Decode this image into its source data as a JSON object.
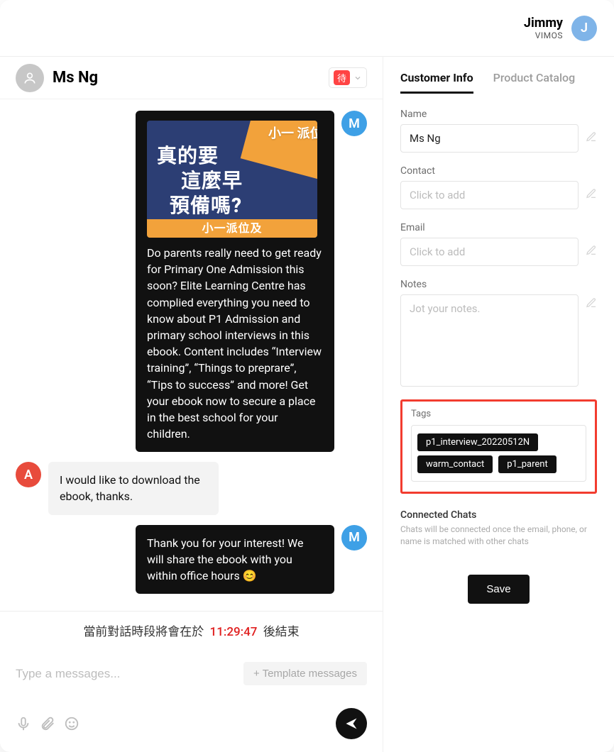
{
  "header": {
    "user_name": "Jimmy",
    "org": "VIMOS",
    "avatar_initial": "J"
  },
  "chat": {
    "contact_name": "Ms Ng",
    "status_badge": "待",
    "messages": [
      {
        "dir": "out",
        "avatar": "M",
        "has_promo": true,
        "promo": {
          "corner": "小一\n派位",
          "main_l1": "真的要",
          "main_l2": "這麼早",
          "main_l3": "預備嗎?",
          "strip": "小一派位及"
        },
        "text": "Do parents really need to get ready for Primary One Admission this soon? Elite Learning Centre has complied everything you need to know about P1 Admission and primary school interviews in this ebook. Content includes “Interview training”, “Things to preprare”, “Tips to success” and more! Get your ebook now to secure a place in the best school for your children."
      },
      {
        "dir": "in",
        "avatar": "A",
        "text": "I would like to download the ebook, thanks."
      },
      {
        "dir": "out",
        "avatar": "M",
        "text": "Thank you for your interest! We will share the ebook with you within office hours 😊"
      }
    ],
    "session": {
      "prefix": "當前對話時段將會在於",
      "time": "11:29:47",
      "suffix": "後結束"
    },
    "composer": {
      "placeholder": "Type a messages...",
      "template_btn": "+ Template messages"
    }
  },
  "side": {
    "tabs": {
      "customer": "Customer Info",
      "catalog": "Product Catalog"
    },
    "fields": {
      "name_label": "Name",
      "name_value": "Ms Ng",
      "contact_label": "Contact",
      "contact_placeholder": "Click to add",
      "email_label": "Email",
      "email_placeholder": "Click to add",
      "notes_label": "Notes",
      "notes_placeholder": "Jot your notes."
    },
    "tags_label": "Tags",
    "tags": [
      "p1_interview_20220512N",
      "warm_contact",
      "p1_parent"
    ],
    "connected": {
      "title": "Connected Chats",
      "sub": "Chats will be connected once the email, phone, or name is matched with other chats"
    },
    "save": "Save"
  }
}
